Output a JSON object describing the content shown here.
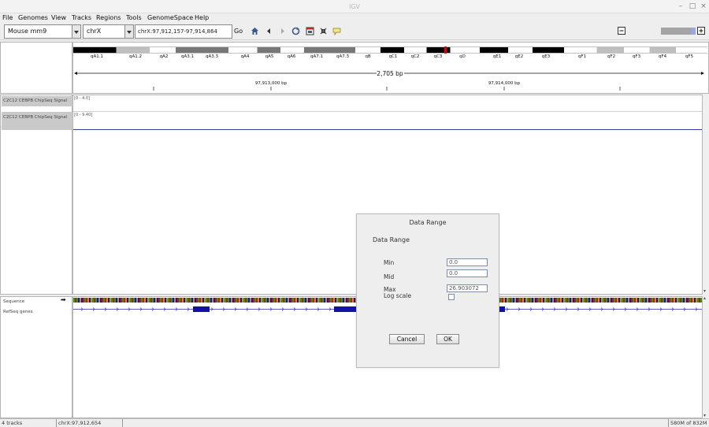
{
  "window": {
    "title": "IGV",
    "minimize": "–",
    "maximize": "□",
    "close": "×"
  },
  "menu": [
    "File",
    "Genomes",
    "View",
    "Tracks",
    "Regions",
    "Tools",
    "GenomeSpace",
    "Help"
  ],
  "toolbar": {
    "genome": "Mouse mm9",
    "chromosome": "chrX",
    "locus": "chrX:97,912,157-97,914,864",
    "go_label": "Go"
  },
  "ideogram": {
    "bands": [
      "qA1.1",
      "qA1.2",
      "qA2",
      "qA3.1",
      "qA3.3",
      "qA4",
      "qA5",
      "qA6",
      "qA7.1",
      "qA7.3",
      "qB",
      "qC1",
      "qC2",
      "qC3",
      "qD",
      "qE1",
      "qE2",
      "qE3",
      "qF1",
      "qF2",
      "qF3",
      "qF4",
      "qF5"
    ]
  },
  "ruler": {
    "span": "2,705 bp",
    "ticks": [
      "97,913,000 bp",
      "97,914,000 bp"
    ]
  },
  "tracks": [
    {
      "name": "C2C12 CEBPB ChipSeq Signal",
      "range": "[0 - 4.0]"
    },
    {
      "name": "C2C12 CEBPB ChipSeq Signal",
      "range": "[0 - 9.40]"
    }
  ],
  "lower_tracks": {
    "sequence": "Sequence",
    "genes": "RefSeq genes",
    "sequence_arrow": "➡"
  },
  "dialog": {
    "title": "Data Range",
    "header": "Data Range",
    "min_label": "Min",
    "min_value": "0.0",
    "mid_label": "Mid",
    "mid_value": "0.0",
    "max_label": "Max",
    "max_value": "26.903072",
    "log_label": "Log scale",
    "log_checked": false,
    "cancel_label": "Cancel",
    "ok_label": "OK"
  },
  "status": {
    "tracks": "4 tracks",
    "position": "chrX:97,912,654",
    "memory": "580M of 832M"
  }
}
